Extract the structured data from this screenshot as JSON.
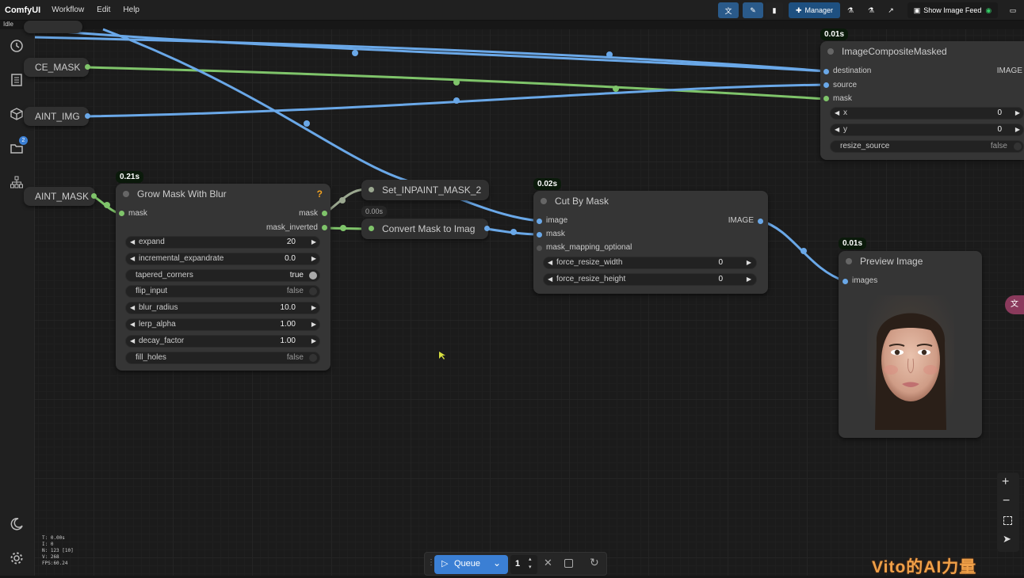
{
  "app": {
    "brand": "ComfyUI",
    "menus": [
      "Workflow",
      "Edit",
      "Help"
    ],
    "status": "Idle"
  },
  "toolbar": {
    "manager_label": "Manager",
    "image_feed_label": "Show Image Feed"
  },
  "sidebar": {
    "badge": "2"
  },
  "colors": {
    "mask_wire": "#7fc46a",
    "image_wire": "#6aa8e8",
    "canvas": "#1b1b1b",
    "node": "#353535"
  },
  "nodes": {
    "stub_source_mask": {
      "title": "CE_MASK"
    },
    "stub_inpaint_img": {
      "title": "AINT_IMG"
    },
    "stub_inpaint_mask": {
      "title": "AINT_MASK"
    },
    "grow_mask": {
      "time": "0.21s",
      "title": "Grow Mask With Blur",
      "help": "?",
      "input": "mask",
      "outputs": [
        "mask",
        "mask_inverted"
      ],
      "widgets": [
        {
          "label": "expand",
          "value": "20",
          "type": "number"
        },
        {
          "label": "incremental_expandrate",
          "value": "0.0",
          "type": "number"
        },
        {
          "label": "tapered_corners",
          "value": "true",
          "type": "toggle"
        },
        {
          "label": "flip_input",
          "value": "false",
          "type": "toggle"
        },
        {
          "label": "blur_radius",
          "value": "10.0",
          "type": "number"
        },
        {
          "label": "lerp_alpha",
          "value": "1.00",
          "type": "number"
        },
        {
          "label": "decay_factor",
          "value": "1.00",
          "type": "number"
        },
        {
          "label": "fill_holes",
          "value": "false",
          "type": "toggle"
        }
      ]
    },
    "set_inpaint": {
      "title": "Set_INPAINT_MASK_2"
    },
    "convert_mask": {
      "time": "0.00s",
      "title": "Convert Mask to Imag"
    },
    "cut_by_mask": {
      "time": "0.02s",
      "title": "Cut By Mask",
      "inputs": [
        "image",
        "mask",
        "mask_mapping_optional"
      ],
      "output": "IMAGE",
      "widgets": [
        {
          "label": "force_resize_width",
          "value": "0"
        },
        {
          "label": "force_resize_height",
          "value": "0"
        }
      ]
    },
    "composite": {
      "time": "0.01s",
      "title": "ImageCompositeMasked",
      "inputs": [
        "destination",
        "source",
        "mask"
      ],
      "output": "IMAGE",
      "widgets": [
        {
          "label": "x",
          "value": "0"
        },
        {
          "label": "y",
          "value": "0"
        },
        {
          "label": "resize_source",
          "value": "false"
        }
      ]
    },
    "preview": {
      "time": "0.01s",
      "title": "Preview Image",
      "input": "images"
    }
  },
  "stats": {
    "lines": [
      "T: 0.00s",
      "I: 0",
      "N: 123 [10]",
      "V: 268",
      "FPS:60.24"
    ]
  },
  "queue": {
    "label": "Queue",
    "count": "1"
  },
  "watermark": "Vito的AI力量"
}
